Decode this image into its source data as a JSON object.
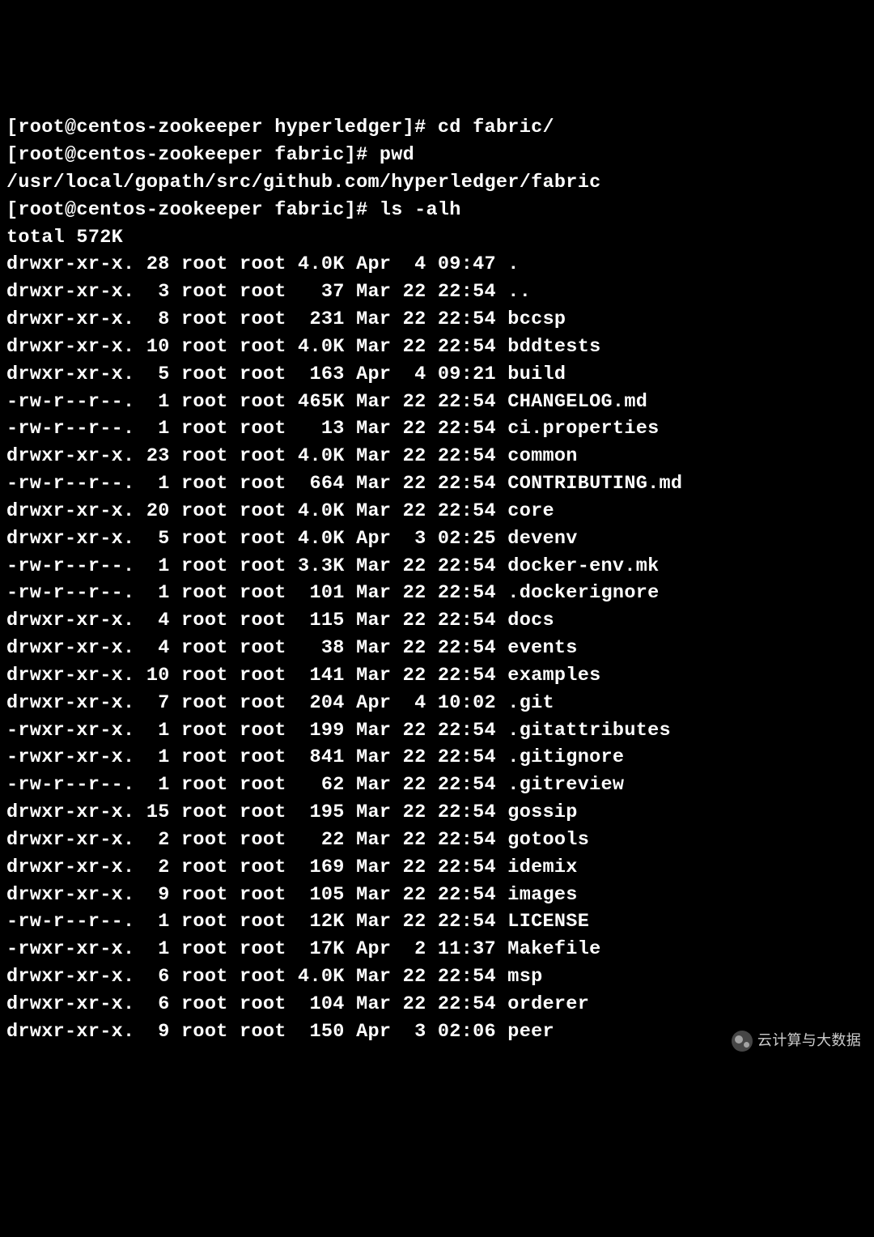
{
  "prompt1": "[root@centos-zookeeper hyperledger]# ",
  "cmd1": "cd fabric/",
  "prompt2": "[root@centos-zookeeper fabric]# ",
  "cmd2": "pwd",
  "pwd_output": "/usr/local/gopath/src/github.com/hyperledger/fabric",
  "prompt3": "[root@centos-zookeeper fabric]# ",
  "cmd3": "ls -alh",
  "total": "total 572K",
  "rows": [
    {
      "perm": "drwxr-xr-x.",
      "links": "28",
      "owner": "root",
      "group": "root",
      "size": "4.0K",
      "month": "Apr",
      "day": " 4",
      "time": "09:47",
      "name": "."
    },
    {
      "perm": "drwxr-xr-x.",
      "links": " 3",
      "owner": "root",
      "group": "root",
      "size": "  37",
      "month": "Mar",
      "day": "22",
      "time": "22:54",
      "name": ".."
    },
    {
      "perm": "drwxr-xr-x.",
      "links": " 8",
      "owner": "root",
      "group": "root",
      "size": " 231",
      "month": "Mar",
      "day": "22",
      "time": "22:54",
      "name": "bccsp"
    },
    {
      "perm": "drwxr-xr-x.",
      "links": "10",
      "owner": "root",
      "group": "root",
      "size": "4.0K",
      "month": "Mar",
      "day": "22",
      "time": "22:54",
      "name": "bddtests"
    },
    {
      "perm": "drwxr-xr-x.",
      "links": " 5",
      "owner": "root",
      "group": "root",
      "size": " 163",
      "month": "Apr",
      "day": " 4",
      "time": "09:21",
      "name": "build"
    },
    {
      "perm": "-rw-r--r--.",
      "links": " 1",
      "owner": "root",
      "group": "root",
      "size": "465K",
      "month": "Mar",
      "day": "22",
      "time": "22:54",
      "name": "CHANGELOG.md"
    },
    {
      "perm": "-rw-r--r--.",
      "links": " 1",
      "owner": "root",
      "group": "root",
      "size": "  13",
      "month": "Mar",
      "day": "22",
      "time": "22:54",
      "name": "ci.properties"
    },
    {
      "perm": "drwxr-xr-x.",
      "links": "23",
      "owner": "root",
      "group": "root",
      "size": "4.0K",
      "month": "Mar",
      "day": "22",
      "time": "22:54",
      "name": "common"
    },
    {
      "perm": "-rw-r--r--.",
      "links": " 1",
      "owner": "root",
      "group": "root",
      "size": " 664",
      "month": "Mar",
      "day": "22",
      "time": "22:54",
      "name": "CONTRIBUTING.md"
    },
    {
      "perm": "drwxr-xr-x.",
      "links": "20",
      "owner": "root",
      "group": "root",
      "size": "4.0K",
      "month": "Mar",
      "day": "22",
      "time": "22:54",
      "name": "core"
    },
    {
      "perm": "drwxr-xr-x.",
      "links": " 5",
      "owner": "root",
      "group": "root",
      "size": "4.0K",
      "month": "Apr",
      "day": " 3",
      "time": "02:25",
      "name": "devenv"
    },
    {
      "perm": "-rw-r--r--.",
      "links": " 1",
      "owner": "root",
      "group": "root",
      "size": "3.3K",
      "month": "Mar",
      "day": "22",
      "time": "22:54",
      "name": "docker-env.mk"
    },
    {
      "perm": "-rw-r--r--.",
      "links": " 1",
      "owner": "root",
      "group": "root",
      "size": " 101",
      "month": "Mar",
      "day": "22",
      "time": "22:54",
      "name": ".dockerignore"
    },
    {
      "perm": "drwxr-xr-x.",
      "links": " 4",
      "owner": "root",
      "group": "root",
      "size": " 115",
      "month": "Mar",
      "day": "22",
      "time": "22:54",
      "name": "docs"
    },
    {
      "perm": "drwxr-xr-x.",
      "links": " 4",
      "owner": "root",
      "group": "root",
      "size": "  38",
      "month": "Mar",
      "day": "22",
      "time": "22:54",
      "name": "events"
    },
    {
      "perm": "drwxr-xr-x.",
      "links": "10",
      "owner": "root",
      "group": "root",
      "size": " 141",
      "month": "Mar",
      "day": "22",
      "time": "22:54",
      "name": "examples"
    },
    {
      "perm": "drwxr-xr-x.",
      "links": " 7",
      "owner": "root",
      "group": "root",
      "size": " 204",
      "month": "Apr",
      "day": " 4",
      "time": "10:02",
      "name": ".git"
    },
    {
      "perm": "-rwxr-xr-x.",
      "links": " 1",
      "owner": "root",
      "group": "root",
      "size": " 199",
      "month": "Mar",
      "day": "22",
      "time": "22:54",
      "name": ".gitattributes"
    },
    {
      "perm": "-rwxr-xr-x.",
      "links": " 1",
      "owner": "root",
      "group": "root",
      "size": " 841",
      "month": "Mar",
      "day": "22",
      "time": "22:54",
      "name": ".gitignore"
    },
    {
      "perm": "-rw-r--r--.",
      "links": " 1",
      "owner": "root",
      "group": "root",
      "size": "  62",
      "month": "Mar",
      "day": "22",
      "time": "22:54",
      "name": ".gitreview"
    },
    {
      "perm": "drwxr-xr-x.",
      "links": "15",
      "owner": "root",
      "group": "root",
      "size": " 195",
      "month": "Mar",
      "day": "22",
      "time": "22:54",
      "name": "gossip"
    },
    {
      "perm": "drwxr-xr-x.",
      "links": " 2",
      "owner": "root",
      "group": "root",
      "size": "  22",
      "month": "Mar",
      "day": "22",
      "time": "22:54",
      "name": "gotools"
    },
    {
      "perm": "drwxr-xr-x.",
      "links": " 2",
      "owner": "root",
      "group": "root",
      "size": " 169",
      "month": "Mar",
      "day": "22",
      "time": "22:54",
      "name": "idemix"
    },
    {
      "perm": "drwxr-xr-x.",
      "links": " 9",
      "owner": "root",
      "group": "root",
      "size": " 105",
      "month": "Mar",
      "day": "22",
      "time": "22:54",
      "name": "images"
    },
    {
      "perm": "-rw-r--r--.",
      "links": " 1",
      "owner": "root",
      "group": "root",
      "size": " 12K",
      "month": "Mar",
      "day": "22",
      "time": "22:54",
      "name": "LICENSE"
    },
    {
      "perm": "-rwxr-xr-x.",
      "links": " 1",
      "owner": "root",
      "group": "root",
      "size": " 17K",
      "month": "Apr",
      "day": " 2",
      "time": "11:37",
      "name": "Makefile"
    },
    {
      "perm": "drwxr-xr-x.",
      "links": " 6",
      "owner": "root",
      "group": "root",
      "size": "4.0K",
      "month": "Mar",
      "day": "22",
      "time": "22:54",
      "name": "msp"
    },
    {
      "perm": "drwxr-xr-x.",
      "links": " 6",
      "owner": "root",
      "group": "root",
      "size": " 104",
      "month": "Mar",
      "day": "22",
      "time": "22:54",
      "name": "orderer"
    },
    {
      "perm": "drwxr-xr-x.",
      "links": " 9",
      "owner": "root",
      "group": "root",
      "size": " 150",
      "month": "Apr",
      "day": " 3",
      "time": "02:06",
      "name": "peer"
    }
  ],
  "watermark": "云计算与大数据"
}
